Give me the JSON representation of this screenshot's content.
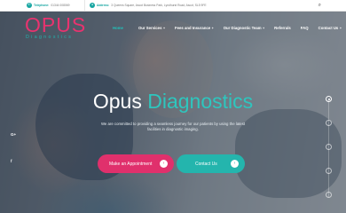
{
  "topbar": {
    "phone_label": "Telephone:",
    "phone_number": "01344 008069",
    "address_label": "Address:",
    "address_text": "3 Queens Square, Ascot Business Park, Lyndhurst Road, Ascot, SL5 9FE",
    "search_icon": "⌕"
  },
  "logo": {
    "word": "OPUS",
    "sub": "Diagnostics"
  },
  "nav": {
    "items": [
      {
        "label": "Home",
        "dropdown": false,
        "active": true
      },
      {
        "label": "Our Services",
        "dropdown": true
      },
      {
        "label": "Fees and Insurance",
        "dropdown": true
      },
      {
        "label": "Our Diagnostic Team",
        "dropdown": true
      },
      {
        "label": "Referrals",
        "dropdown": false
      },
      {
        "label": "FAQ",
        "dropdown": false
      },
      {
        "label": "Contact Us",
        "dropdown": true
      }
    ],
    "caret": "+"
  },
  "hero": {
    "title_white": "Opus",
    "title_accent": "Diagnostics",
    "subtitle": "We are committed to providing a seamless journey for our patients by using the latest facilities in diagnostic imaging.",
    "appointment_label": "Make an Appointment",
    "contact_label": "Contact Us",
    "arrow": "›"
  },
  "social": {
    "google_plus": "G+",
    "facebook": "f"
  },
  "slider": {
    "count": 5,
    "active_index": 0
  },
  "colors": {
    "pink": "#e0306c",
    "teal": "#24b5ad"
  }
}
